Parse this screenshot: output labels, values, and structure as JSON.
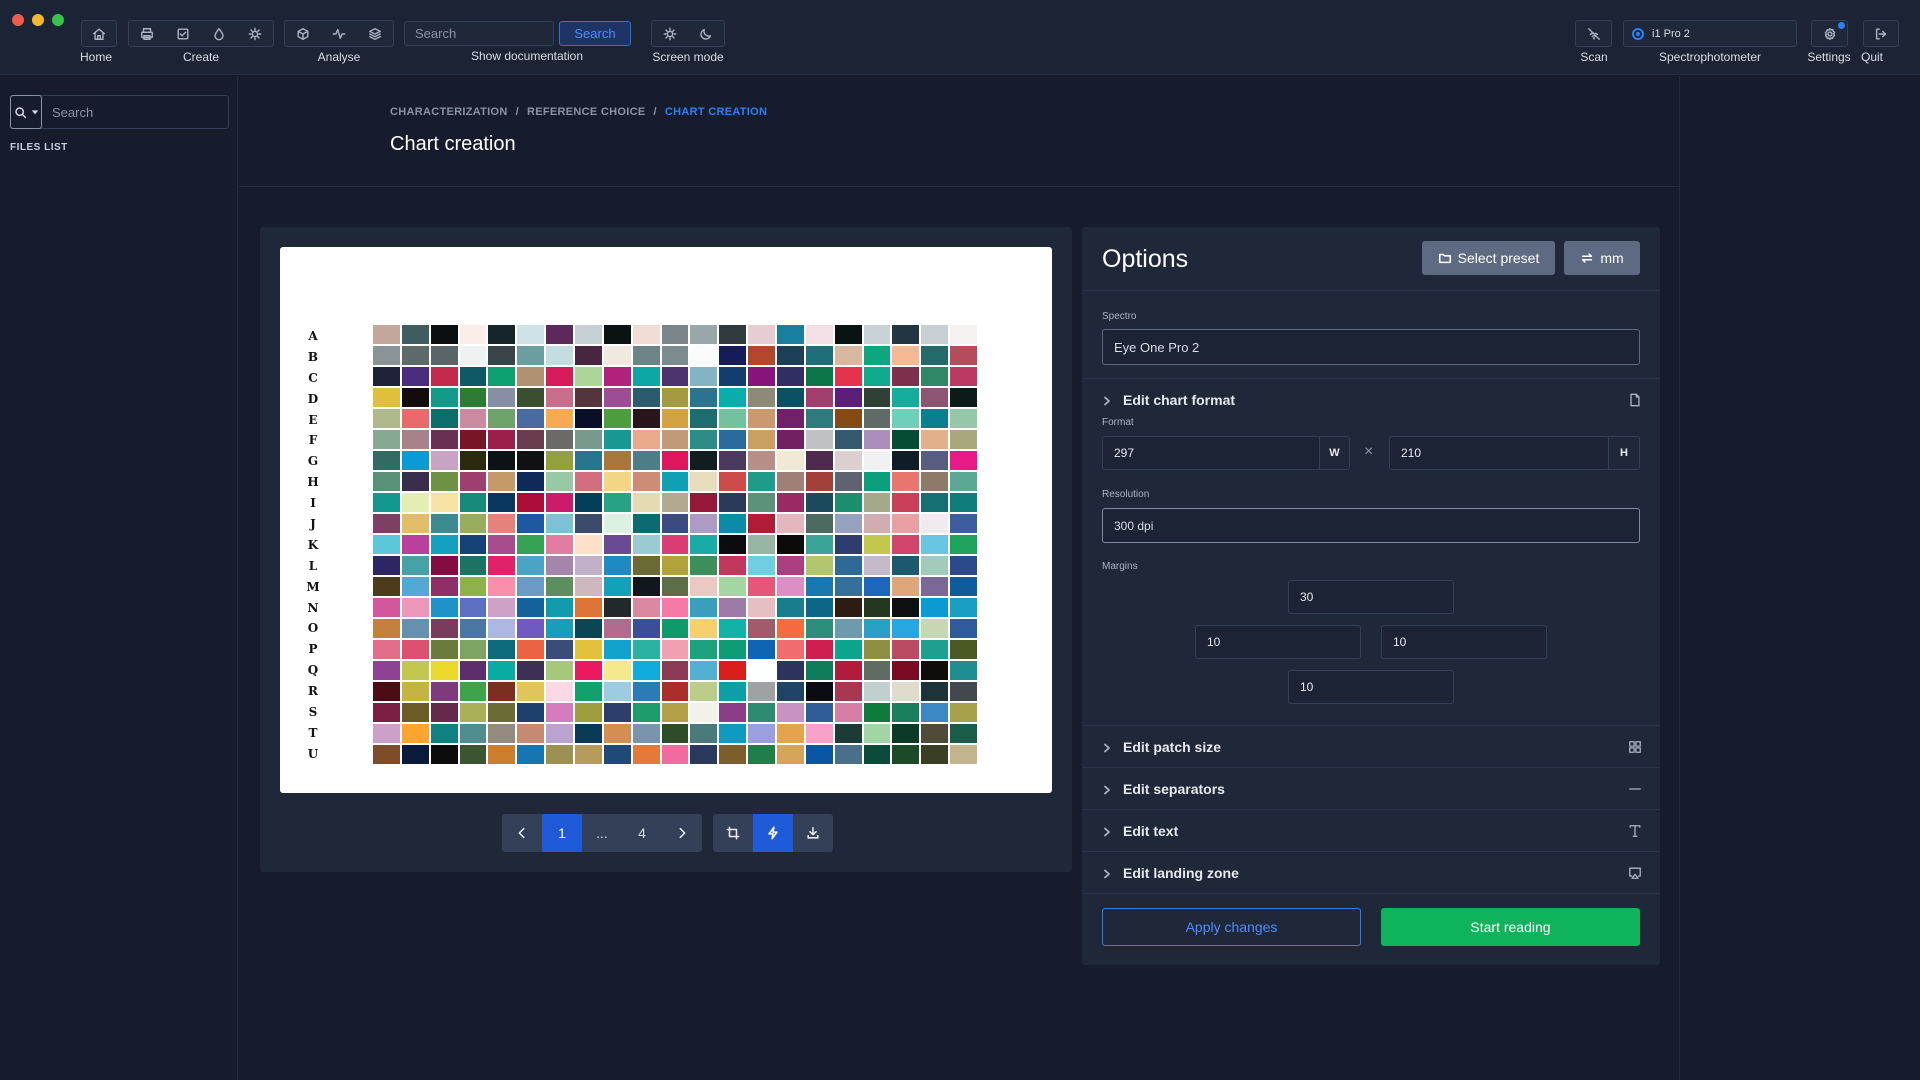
{
  "window": {
    "controls": [
      "close",
      "minimize",
      "maximize"
    ]
  },
  "toolbar": {
    "home_label": "Home",
    "create_label": "Create",
    "analyse_label": "Analyse",
    "search_placeholder": "Search",
    "search_button": "Search",
    "docs_label": "Show documentation",
    "screen_mode_label": "Screen mode",
    "scan_label": "Scan",
    "spectro_value": "i1 Pro 2",
    "spectro_label": "Spectrophotometer",
    "settings_label": "Settings",
    "quit_label": "Quit"
  },
  "sidebar": {
    "search_placeholder": "Search",
    "files_list_label": "FILES LIST"
  },
  "breadcrumb": [
    "CHARACTERIZATION",
    "REFERENCE CHOICE",
    "CHART CREATION"
  ],
  "breadcrumb_sep": "/",
  "page_title": "Chart creation",
  "preview": {
    "row_labels": [
      "A",
      "B",
      "C",
      "D",
      "E",
      "F",
      "G",
      "H",
      "I",
      "J",
      "K",
      "L",
      "M",
      "N",
      "O",
      "P",
      "Q",
      "R",
      "S",
      "T",
      "U"
    ],
    "pagination": {
      "current": "1",
      "ellipsis": "...",
      "last": "4"
    },
    "patches": [
      "#c4a79c",
      "#3f5c60",
      "#0c0e11",
      "#fbeee8",
      "#15262a",
      "#cfe3e6",
      "#5b2a5a",
      "#c6cfd3",
      "#0b1214",
      "#f1dcd6",
      "#7b8589",
      "#98a7a9",
      "#2e3a3d",
      "#e7ccd2",
      "#1a7e9f",
      "#f3dfe5",
      "#0a1312",
      "#c9d2d6",
      "#213640",
      "#c7cfd3",
      "#f4f3f1",
      "#8a9497",
      "#5c6a6b",
      "#5b6467",
      "#eff1f3",
      "#394448",
      "#6a9e9f",
      "#c5dde0",
      "#49253f",
      "#efe9e0",
      "#6d8385",
      "#7a8c8e",
      "#fbfbfb",
      "#161b5a",
      "#b3472c",
      "#1c3f58",
      "#1f6f7b",
      "#d9b8a0",
      "#0da67f",
      "#f7b894",
      "#236a6a",
      "#b44c5a",
      "#1e2238",
      "#4a2d7c",
      "#c42a4c",
      "#0d5965",
      "#0ca073",
      "#b09272",
      "#d41c5a",
      "#abd599",
      "#b1227d",
      "#0ca7a4",
      "#4d336e",
      "#83b4c3",
      "#133d6e",
      "#88147b",
      "#322e63",
      "#0a7547",
      "#e5334e",
      "#0fa98d",
      "#7e2f4c",
      "#2e8767",
      "#bb3962",
      "#dfbf3b",
      "#120c0d",
      "#139b8a",
      "#2f7b35",
      "#888ea4",
      "#3b4f30",
      "#c86d8c",
      "#55343b",
      "#9c4d96",
      "#2c5a6e",
      "#a49b41",
      "#2a7490",
      "#0aadac",
      "#8f897a",
      "#0c5063",
      "#a23f6f",
      "#5d1e77",
      "#2f4034",
      "#13ad9b",
      "#8e5572",
      "#0c1a18",
      "#afb98b",
      "#e86a6b",
      "#0c6e6a",
      "#ca8aa0",
      "#6ea26a",
      "#4a6ba2",
      "#f7aa52",
      "#0a0f29",
      "#4b9d3e",
      "#2a141c",
      "#d2a343",
      "#1c6d70",
      "#74c19f",
      "#c89a6e",
      "#722169",
      "#2f7a7c",
      "#854b12",
      "#5f6b67",
      "#6ed0b8",
      "#0b7e8f",
      "#96c7a9",
      "#87a991",
      "#a8818a",
      "#6a3054",
      "#781628",
      "#9c1e4a",
      "#6a3a4f",
      "#6b6a66",
      "#789a8c",
      "#199793",
      "#e9a98a",
      "#c19a78",
      "#2d8c86",
      "#2a6b9e",
      "#c9a062",
      "#732062",
      "#c0c1c5",
      "#34586e",
      "#aa8fbc",
      "#064c34",
      "#e2b189",
      "#a9a77c",
      "#306c62",
      "#0a9bd7",
      "#c9a3c4",
      "#2d290e",
      "#0d1216",
      "#101113",
      "#93a03c",
      "#28768d",
      "#a9773e",
      "#4d7e88",
      "#e0155e",
      "#111d1e",
      "#493a5e",
      "#b88e88",
      "#f1e9d6",
      "#4f2a4f",
      "#dccfd0",
      "#f0f1f2",
      "#111d26",
      "#585c7e",
      "#e81b86",
      "#599178",
      "#3a2f4b",
      "#6d9246",
      "#9e3f70",
      "#c49a6a",
      "#0f2a58",
      "#97c9a4",
      "#d36e7f",
      "#f2d685",
      "#ce8b75",
      "#109fb3",
      "#e7dcbb",
      "#cb4c4a",
      "#1f9b8b",
      "#9f7f77",
      "#a4403c",
      "#5e636f",
      "#0a9e7e",
      "#e9756f",
      "#8e7a68",
      "#5ba896",
      "#14978f",
      "#e4eeb4",
      "#f8e2a3",
      "#178a7c",
      "#08365f",
      "#ab0d37",
      "#cb1c6c",
      "#043e5b",
      "#28a185",
      "#e5dbb2",
      "#b2a990",
      "#951839",
      "#2a3a58",
      "#5c9279",
      "#9a2a62",
      "#1c4a5a",
      "#1b8e6e",
      "#a5a98b",
      "#ca3f5c",
      "#166f70",
      "#0f7d7c",
      "#7d3f63",
      "#e1bd68",
      "#3a8a90",
      "#99ae5c",
      "#e5827b",
      "#1d59a0",
      "#7cc2d5",
      "#3c4a6e",
      "#dcf1e2",
      "#0b6b71",
      "#3c4a82",
      "#ad9bc5",
      "#0c8ba8",
      "#b01c34",
      "#e3b7bd",
      "#4b6b60",
      "#97a2c1",
      "#d1adb3",
      "#e99fa4",
      "#f1ebf1",
      "#3c5e9e",
      "#5cc6da",
      "#b93f9b",
      "#16a0c0",
      "#16427a",
      "#a54c8c",
      "#34a154",
      "#e27ca1",
      "#ffe1c9",
      "#6a4a92",
      "#9acbd2",
      "#da3d73",
      "#19aba5",
      "#0b0c0f",
      "#97b5a2",
      "#0d0a0a",
      "#3aa596",
      "#2e3d6f",
      "#c5c74d",
      "#d1456d",
      "#67c6e1",
      "#1ea35d",
      "#2c2764",
      "#46a2a6",
      "#850c41",
      "#1b7363",
      "#e1226b",
      "#4ba4c3",
      "#a586ab",
      "#c1b0c8",
      "#1d8ac4",
      "#6a6b34",
      "#b1a23b",
      "#3a8f5c",
      "#c0385e",
      "#6ecee2",
      "#ac3f81",
      "#b2c76c",
      "#2d6a96",
      "#c3b9c8",
      "#1d5870",
      "#a3cbbb",
      "#2b4a8c",
      "#4d3b1c",
      "#52a9d3",
      "#8d2f68",
      "#8db24a",
      "#fa8fac",
      "#6c9ac6",
      "#5b8f5e",
      "#d0b6bf",
      "#12a0bb",
      "#10181d",
      "#5d6e46",
      "#e9c9c2",
      "#a4d6a3",
      "#e55678",
      "#db8fc4",
      "#1977b1",
      "#33709c",
      "#1d66bb",
      "#dea67a",
      "#7b6896",
      "#0f5b9b",
      "#d3579c",
      "#eb97b9",
      "#1f93c7",
      "#5b70c1",
      "#cfa0c8",
      "#14629a",
      "#0f9bab",
      "#dc7337",
      "#21292b",
      "#da8aa0",
      "#f57aa8",
      "#3a9fbc",
      "#9e7aa8",
      "#e6bfc2",
      "#1a7d8d",
      "#0d6587",
      "#2c1c13",
      "#25381f",
      "#0c1012",
      "#0c9ad4",
      "#1a9ec3",
      "#c3813b",
      "#6790b0",
      "#7a3c5c",
      "#4a76a2",
      "#aeb7e1",
      "#6e5ac0",
      "#16a0b7",
      "#0d4553",
      "#b06b8e",
      "#3c4e99",
      "#0e9a6b",
      "#f6d06a",
      "#12b3a7",
      "#a05c6a",
      "#f56b3e",
      "#2a8e7b",
      "#6d9bac",
      "#28a1c4",
      "#28a6e4",
      "#c6d7b4",
      "#2e5c99",
      "#e36e8c",
      "#dc4f6e",
      "#6a7c3a",
      "#7fa362",
      "#0d6a7a",
      "#ea6443",
      "#3a4d78",
      "#e2c13c",
      "#12a2ce",
      "#2bb1a1",
      "#f1a0b0",
      "#1ca37d",
      "#0d9c73",
      "#0f65b4",
      "#f06c6e",
      "#cf1f4f",
      "#0ba58d",
      "#8e8f43",
      "#ba4a61",
      "#1f9f90",
      "#4b5a25",
      "#8f4193",
      "#c2c74d",
      "#ecd92e",
      "#5c2e6c",
      "#09aba5",
      "#3d2f55",
      "#a7c87b",
      "#e9195f",
      "#f6e88c",
      "#10aadd",
      "#8a3a55",
      "#52b0d2",
      "#d91e1e",
      "#fdfefe",
      "#2c335c",
      "#0f7d5b",
      "#b11c3d",
      "#5e6c61",
      "#7b0a23",
      "#0f0c0c",
      "#1f8e90",
      "#4c0c13",
      "#c4b443",
      "#7e3a7a",
      "#3ea34b",
      "#7d2f1f",
      "#e3c35c",
      "#fad9e4",
      "#12a06c",
      "#9dcbe1",
      "#2a7cb4",
      "#ab2f28",
      "#bccc8b",
      "#0d9eaa",
      "#a0a1a3",
      "#1f4466",
      "#0b0c12",
      "#a83852",
      "#c1d0ce",
      "#e0dccd",
      "#1e323a",
      "#43474e",
      "#7b1f45",
      "#6b5c26",
      "#632a4b",
      "#a9b059",
      "#6b6b34",
      "#20406c",
      "#d57bc0",
      "#9e9e3f",
      "#2d3e6c",
      "#1d9d6b",
      "#b1a046",
      "#f2f2ea",
      "#893e87",
      "#2c8b70",
      "#ca92c2",
      "#2f5d98",
      "#d77ea6",
      "#0e7b3c",
      "#1a7f5c",
      "#3c87c4",
      "#a8a14b",
      "#cca0c8",
      "#fda52f",
      "#0f8181",
      "#4f8d8e",
      "#938c7e",
      "#c48a74",
      "#b9a4d0",
      "#0b3a58",
      "#d48e53",
      "#7a94ad",
      "#2d4c27",
      "#4a7a7a",
      "#0f9ac1",
      "#9b9fe0",
      "#e5a44c",
      "#f9a2c9",
      "#1c3a36",
      "#a3d4a5",
      "#0d3a26",
      "#4e4b38",
      "#1b5b4a",
      "#7f4c2a",
      "#0a1a3a",
      "#0c0c0c",
      "#3a5530",
      "#ca7e2e",
      "#1776b0",
      "#9c9052",
      "#b89b5a",
      "#1f4a78",
      "#e4793a",
      "#f06ca0",
      "#2a3a5c",
      "#7b5e2a",
      "#1f7e4a",
      "#d4a45a",
      "#0a56a2",
      "#4a6f8a",
      "#0c4a3a",
      "#1d4a26",
      "#3a3f24",
      "#c2b48c"
    ]
  },
  "options": {
    "title": "Options",
    "select_preset": "Select preset",
    "unit_button": "mm",
    "spectro_label": "Spectro",
    "spectro_value": "Eye One Pro 2",
    "edit_chart_format": "Edit chart format",
    "format_label": "Format",
    "format_width": "297",
    "width_unit": "W",
    "times": "×",
    "format_height": "210",
    "height_unit": "H",
    "resolution_label": "Resolution",
    "resolution_value": "300 dpi",
    "margins_label": "Margins",
    "margin_top": "30",
    "margin_left": "10",
    "margin_right": "10",
    "margin_bottom": "10",
    "edit_patch_size": "Edit patch size",
    "edit_separators": "Edit separators",
    "edit_text": "Edit text",
    "edit_landing_zone": "Edit landing zone",
    "apply_changes": "Apply changes",
    "start_reading": "Start reading"
  }
}
